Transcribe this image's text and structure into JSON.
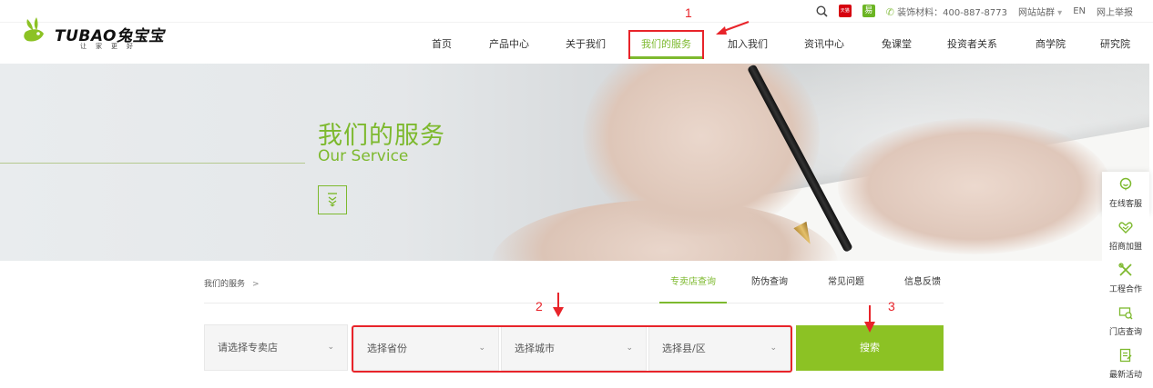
{
  "utility": {
    "tmall_label": "天猫",
    "yi_label": "易",
    "phone_label": "装饰材料：400-887-8773",
    "sites_label": "网站站群",
    "lang_label": "EN",
    "report_label": "网上举报"
  },
  "brand": {
    "logo_text": "TUBAO兔宝宝",
    "slogan": "让家更好"
  },
  "nav": {
    "items": [
      {
        "label": "首页"
      },
      {
        "label": "产品中心"
      },
      {
        "label": "关于我们"
      },
      {
        "label": "我们的服务"
      },
      {
        "label": "加入我们"
      },
      {
        "label": "资讯中心"
      },
      {
        "label": "兔课堂"
      },
      {
        "label": "投资者关系"
      },
      {
        "label": "商学院"
      },
      {
        "label": "研究院"
      }
    ],
    "active_index": 3
  },
  "hero": {
    "title": "我们的服务",
    "subtitle": "Our Service"
  },
  "sidebar": {
    "items": [
      {
        "label": "在线客服",
        "icon": "chat-icon"
      },
      {
        "label": "招商加盟",
        "icon": "handshake-icon"
      },
      {
        "label": "工程合作",
        "icon": "tools-icon"
      },
      {
        "label": "门店查询",
        "icon": "store-search-icon"
      },
      {
        "label": "最新活动",
        "icon": "activity-icon"
      }
    ]
  },
  "breadcrumb": {
    "current": "我们的服务",
    "separator": ">"
  },
  "tabs": [
    {
      "label": "专卖店查询",
      "active": true
    },
    {
      "label": "防伪查询",
      "active": false
    },
    {
      "label": "常见问题",
      "active": false
    },
    {
      "label": "信息反馈",
      "active": false
    }
  ],
  "search": {
    "store_select": "请选择专卖店",
    "province_select": "选择省份",
    "city_select": "选择城市",
    "district_select": "选择县/区",
    "button_label": "搜索"
  },
  "annotations": {
    "one": "1",
    "two": "2",
    "three": "3"
  },
  "colors": {
    "brand_green": "#7db92e",
    "button_green": "#8cc224",
    "annotation_red": "#e8242a"
  }
}
